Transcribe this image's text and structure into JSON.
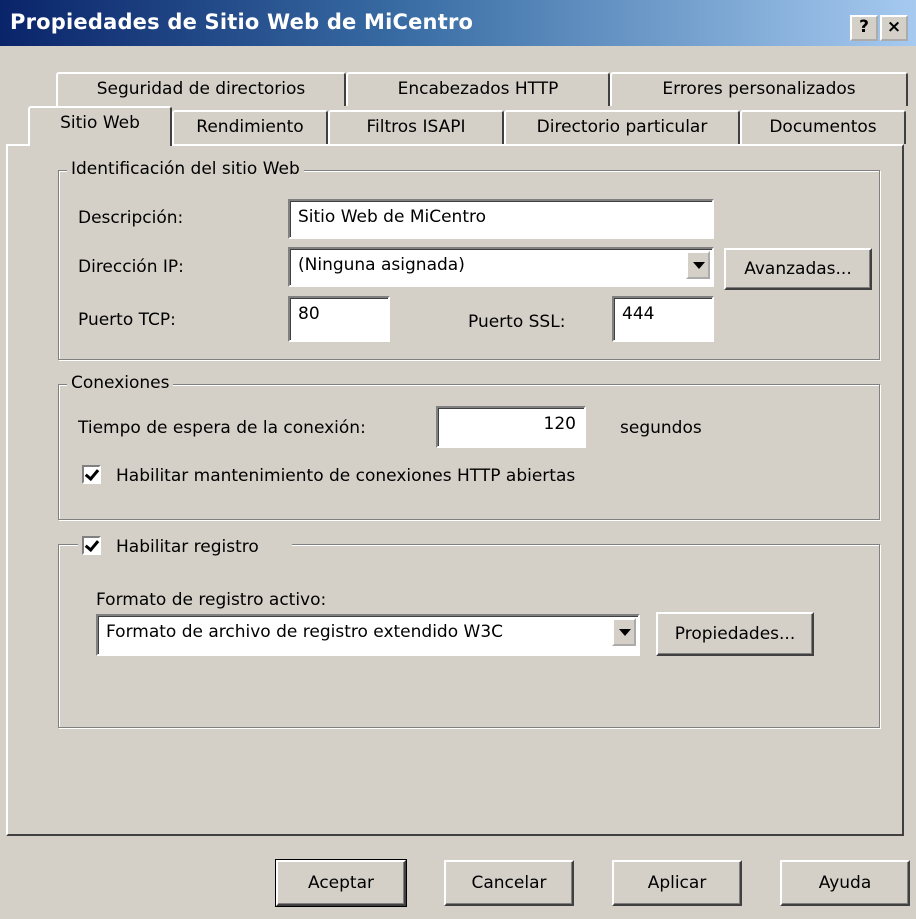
{
  "window": {
    "title": "Propiedades de Sitio Web de MiCentro",
    "help_btn": "?",
    "close_btn": "×"
  },
  "tabs_back": [
    {
      "label": "Seguridad de directorios"
    },
    {
      "label": "Encabezados HTTP"
    },
    {
      "label": "Errores personalizados"
    }
  ],
  "tabs_front": [
    {
      "label": "Sitio Web",
      "active": true
    },
    {
      "label": "Rendimiento"
    },
    {
      "label": "Filtros ISAPI"
    },
    {
      "label": "Directorio particular"
    },
    {
      "label": "Documentos"
    }
  ],
  "identification": {
    "legend": "Identificación del sitio Web",
    "description_label": "Descripción:",
    "description_value": "Sitio Web de MiCentro",
    "ip_label": "Dirección IP:",
    "ip_value": "(Ninguna asignada)",
    "advanced_button": "Avanzadas...",
    "tcp_label": "Puerto TCP:",
    "tcp_value": "80",
    "ssl_label": "Puerto SSL:",
    "ssl_value": "444"
  },
  "connections": {
    "legend": "Conexiones",
    "timeout_label": "Tiempo de espera de la conexión:",
    "timeout_value": "120",
    "timeout_unit": "segundos",
    "keepalive_label": "Habilitar mantenimiento de conexiones HTTP abiertas",
    "keepalive_checked": true
  },
  "logging": {
    "enable_label": "Habilitar registro",
    "enable_checked": true,
    "format_label": "Formato de registro activo:",
    "format_value": "Formato de archivo de registro extendido W3C",
    "properties_button": "Propiedades..."
  },
  "footer": {
    "ok": "Aceptar",
    "cancel": "Cancelar",
    "apply": "Aplicar",
    "help": "Ayuda"
  }
}
